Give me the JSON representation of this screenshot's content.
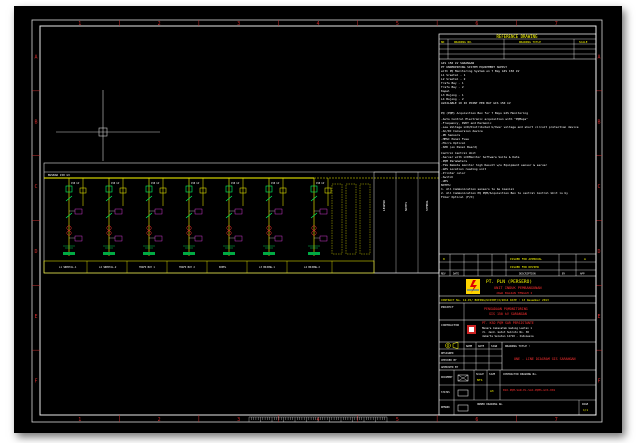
{
  "zone_labels": {
    "top": [
      "1",
      "2",
      "3",
      "4",
      "5",
      "6",
      "7"
    ],
    "bottom": [
      "1",
      "2",
      "3",
      "4",
      "5",
      "6",
      "7"
    ],
    "left": [
      "A",
      "B",
      "C",
      "D",
      "E",
      "F"
    ],
    "right": [
      "A",
      "B",
      "C",
      "D",
      "E",
      "F"
    ]
  },
  "title_block": {
    "reference_drawing": "REFERENCE DRAWING",
    "ref_headers": [
      "NO",
      "DRAWING NO.",
      "DRAWING TITLE",
      "SCALE"
    ],
    "ref_rows": [
      [
        "",
        "",
        "",
        ""
      ],
      [
        "",
        "",
        "",
        ""
      ],
      [
        "",
        "",
        "",
        ""
      ]
    ],
    "general_notes": [
      "GIS 150 kV SARANGAN",
      "PT UNDERPIPING SISTEM EQUIPMENT SUPPLY",
      "with PQ Monitoring System on 7 Bay GIS 150 kV",
      "L1 Sreotal - 1",
      "L2 Sreotal - 2",
      "Trafo Bay - 1",
      "Trafo Bay - 2",
      "Kopel",
      "L3 Bojong - 1",
      "L4 Bojong - 2",
      "AVAILABLE 10 IO POINT PER BAY GIS 150 kV"
    ],
    "feature_heading": "PQ (PQM) Acquisition Box for 7 Bays GIS Monitoring",
    "features": [
      "-Auto Control Electronic acquisition with \"PQMaps\"",
      "-Frequency, DVDT and Harmonic",
      "-Low Voltage LCD/Distributed U/Over voltage and short circuit protection device",
      "-AC/DC Conversion device",
      "-PD Sensors",
      "-HMSC Panel Fuse",
      "-Micro Optical",
      "-SPD (on Panel Board)"
    ],
    "control_heading": "Control Central Unit",
    "controls": [
      "-Server with LCDMonitor Software Suite & Data",
      "-PQM Parameters",
      "-TSG Remote monitor high Result w/o Equipment sensor & server",
      "-GPS Location reading unit",
      "-Printer color",
      "-Switch",
      "-UPS"
    ],
    "notes_heading": "NOTES:",
    "notes": [
      "1. All Communication sensors to be Coaxial",
      "2. All Communication PQ PQM/Acquisition Box to central Control Unit is by",
      "   Fiber Optical (F/O)"
    ],
    "rev_headers": [
      "REV",
      "DATE",
      "DESCRIPTION",
      "BY",
      "CHK",
      "APP"
    ],
    "rev_row": [
      "0",
      "",
      "ISSUED FOR APPROVAL",
      "",
      "",
      "A"
    ],
    "rev_row2": [
      "",
      "",
      "ISSUED FOR REVIEW",
      ""
    ],
    "company": "PT. PLN (PERSERO)",
    "company_sub1": "UNIT INDUK PEMBANGUNAN",
    "company_sub2": "JAWA BAGIAN TENGAH I",
    "contract_no": "CONTRACT No. 12-PJ/ BOEING/UIPJBT/I/2014 DATE : 13 Desember 2013",
    "project_label": "PROJECT",
    "project_line1": "PENGADAAN PQMONITORING",
    "project_line2": "GIS 150 kV SARANGAN",
    "contractor_label": "CONTRACTOR",
    "contractor_name": "PT. KSO PQM SAR PERSISTANTE",
    "contractor_addr1": "Menara Jamsostek Gedung Lantai 1",
    "contractor_addr2": "Jl. Jend. Gatot Subroto No. 38",
    "contractor_addr3": "Jakarta Selatan 12710 - Indonesia",
    "sign_headers": [
      "NAME",
      "DATE",
      "SIGN"
    ],
    "sign_rows": [
      "DESIGNED",
      "CHECKED BY",
      "APPROVED BY"
    ],
    "drawing_title_label": "DRAWING TITLE :",
    "drawing_title": "ONE - LINE DIAGRAM GIS SARANGAN",
    "scale_label": "SCALE",
    "scale_value": "NTS",
    "size_label": "SIZE",
    "size_value": "A3",
    "contractor_dwg_label": "CONTRACTOR DRAWING No.",
    "contractor_dwg_no": "KSO-PQM-SAR-EL-SLD-PQMS-GIS-001",
    "owner_dwg_label": "OWNER DRAWING No.",
    "owner_dwg_no": "",
    "page_label": "PAGE",
    "page_value": "1/1",
    "misc_labels": [
      "DOCUMENT",
      "STATUS",
      "REMARK"
    ]
  },
  "diagram": {
    "bay_labels": [
      "L1 SREOTAL-1",
      "L2 SREOTAL-2",
      "TRAFO BAY 1",
      "TRAFO BAY 2",
      "KOPEL",
      "L3 BOJONG-1",
      "L4 BOJONG-2"
    ],
    "bay_numbers": [
      "150 kV",
      "150 kV",
      "150 kV",
      "150 kV",
      "150 kV",
      "150 kV",
      "150 kV"
    ],
    "busbar_label": "BUSBAR 150 kV",
    "legend_titles": [
      "LEGEND",
      "NOTES",
      "SYMBOL"
    ]
  }
}
